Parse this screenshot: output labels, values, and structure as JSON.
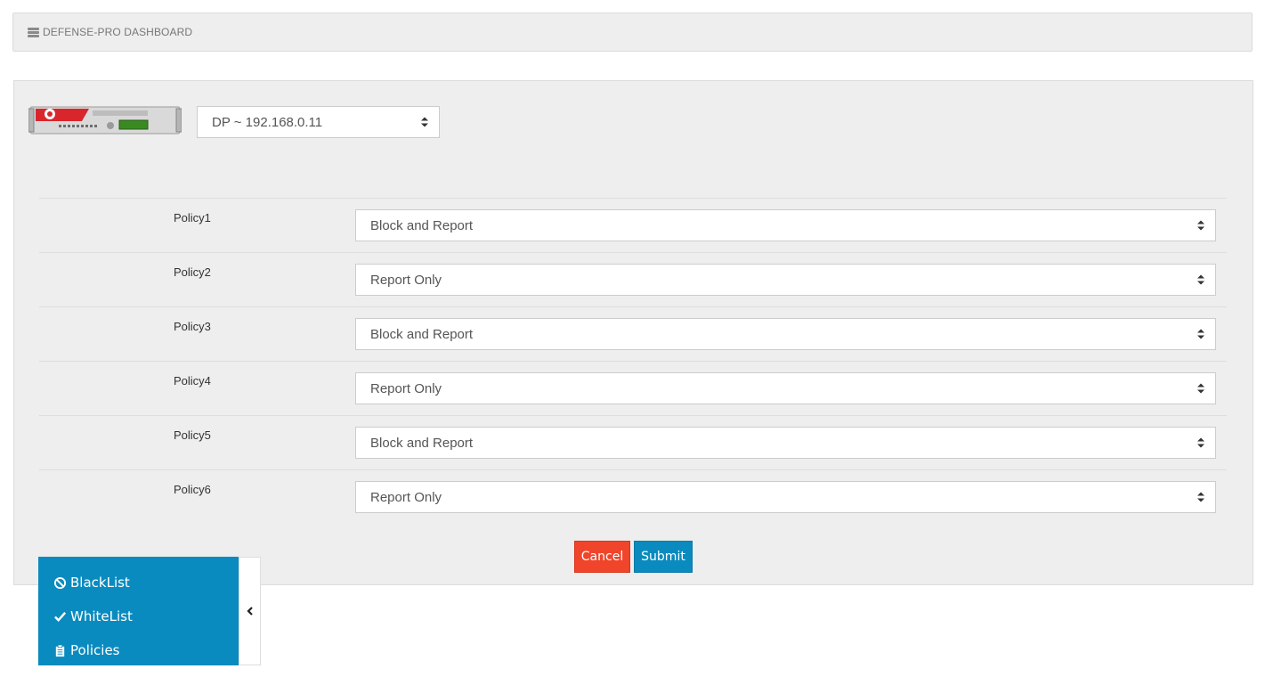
{
  "header": {
    "title": "DEFENSE-PRO DASHBOARD",
    "icon": "server-icon"
  },
  "device": {
    "image": "defensepro-appliance-image",
    "selected": "DP ~ 192.168.0.11"
  },
  "policies": [
    {
      "label": "Policy1",
      "value": "Block and Report"
    },
    {
      "label": "Policy2",
      "value": "Report Only"
    },
    {
      "label": "Policy3",
      "value": "Block and Report"
    },
    {
      "label": "Policy4",
      "value": "Report Only"
    },
    {
      "label": "Policy5",
      "value": "Block and Report"
    },
    {
      "label": "Policy6",
      "value": "Report Only"
    }
  ],
  "actions": {
    "cancel_label": "Cancel",
    "submit_label": "Submit"
  },
  "side_menu": {
    "items": [
      {
        "label": "BlackList",
        "icon": "ban-icon"
      },
      {
        "label": "WhiteList",
        "icon": "check-icon"
      },
      {
        "label": "Policies",
        "icon": "clipboard-icon"
      }
    ],
    "toggle_icon": "chevron-left-icon"
  },
  "colors": {
    "accent": "#0a8bbf",
    "cancel": "#f0452a",
    "panel_bg": "#eeeeee"
  }
}
